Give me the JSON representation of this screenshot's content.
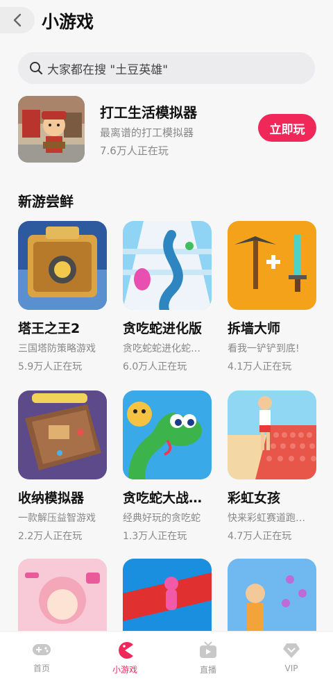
{
  "header": {
    "title": "小游戏"
  },
  "search": {
    "placeholder": "大家都在搜 \"土豆英雄\""
  },
  "featured": {
    "name": "打工生活模拟器",
    "desc": "最离谱的打工模拟器",
    "players": "7.6万人正在玩",
    "button": "立即玩"
  },
  "section": {
    "title": "新游尝鲜"
  },
  "games": [
    {
      "name": "塔王之王2",
      "desc": "三国塔防策略游戏",
      "players": "5.9万人正在玩"
    },
    {
      "name": "贪吃蛇进化版",
      "desc": "贪吃蛇蛇进化蛇…",
      "players": "6.0万人正在玩"
    },
    {
      "name": "拆墙大师",
      "desc": "看我一铲铲到底!",
      "players": "4.1万人正在玩"
    },
    {
      "name": "收纳模拟器",
      "desc": "一款解压益智游戏",
      "players": "2.2万人正在玩"
    },
    {
      "name": "贪吃蛇大战…",
      "desc": "经典好玩的贪吃蛇",
      "players": "1.3万人正在玩"
    },
    {
      "name": "彩虹女孩",
      "desc": "快来彩虹赛道跑…",
      "players": "4.7万人正在玩"
    }
  ],
  "tabs": [
    {
      "label": "首页",
      "icon": "gamepad-icon"
    },
    {
      "label": "小游戏",
      "icon": "pacman-icon",
      "active": true
    },
    {
      "label": "直播",
      "icon": "tv-icon"
    },
    {
      "label": "VIP",
      "icon": "diamond-heart-icon"
    }
  ],
  "colors": {
    "accent": "#f0285a",
    "background": "#f7f7f7"
  }
}
